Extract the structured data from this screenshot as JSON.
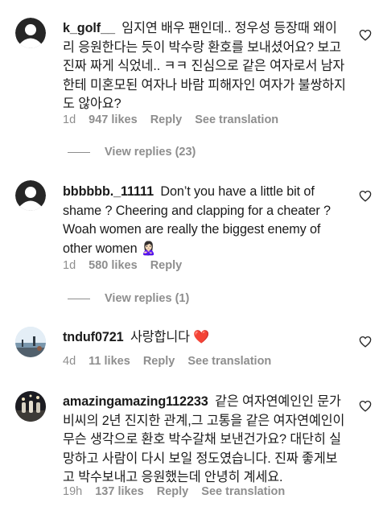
{
  "comments": [
    {
      "username": "k_golf__",
      "text": "임지연 배우 팬인데.. 정우성 등장때 왜이리 응원한다는 듯이 박수랑 환호를 보내셨어요? 보고 진짜 짜게 식었네.. ㅋㅋ 진심으로 같은 여자로서 남자한테 미혼모된 여자나 바람 피해자인 여자가 불쌍하지도 않아요?",
      "time": "1d",
      "likes": "947 likes",
      "reply_label": "Reply",
      "translate_label": "See translation",
      "view_replies": "View replies (23)"
    },
    {
      "username": "bbbbbb._11111",
      "text": "Don’t you have a little bit of shame ? Cheering and clapping for a cheater ? Woah women are really the biggest enemy of other women 🙎🏻‍♀️",
      "time": "1d",
      "likes": "580 likes",
      "reply_label": "Reply",
      "view_replies": "View replies (1)"
    },
    {
      "username": "tnduf0721",
      "text": "사랑합니다",
      "emoji": "❤️",
      "time": "4d",
      "likes": "11 likes",
      "reply_label": "Reply",
      "translate_label": "See translation"
    },
    {
      "username": "amazingamazing112233",
      "text": "같은 여자연예인인 문가비씨의 2년 진지한 관계,그 고통을 같은 여자연예인이 무슨 생각으로 환호 박수갈채 보낸건가요? 대단히 실망하고 사람이 다시 보일 정도였습니다. 진짜 좋게보고 박수보내고 응원했는데 안녕히 계세요.",
      "time": "19h",
      "likes": "137 likes",
      "reply_label": "Reply",
      "translate_label": "See translation"
    }
  ]
}
